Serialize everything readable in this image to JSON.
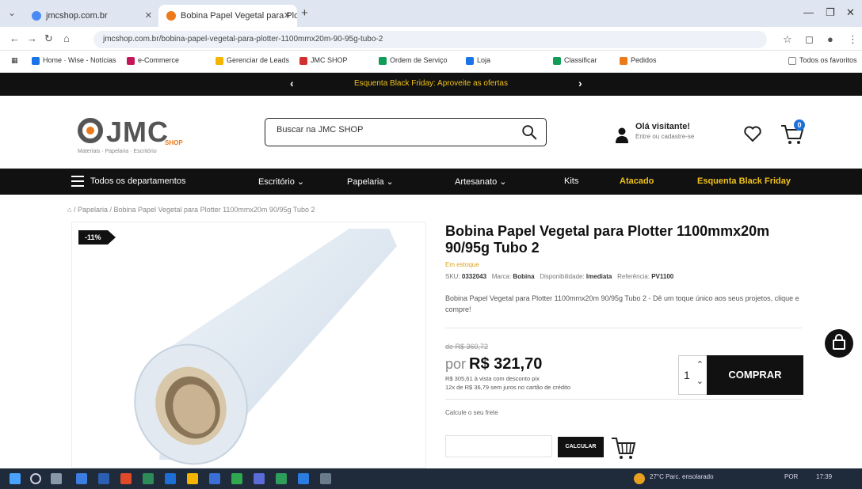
{
  "browser": {
    "tab1": {
      "title": "jmcshop.com.br"
    },
    "tab2": {
      "title": "Bobina Papel Vegetal para Plo"
    },
    "url": "jmcshop.com.br/bobina-papel-vegetal-para-plotter-1100mmx20m-90-95g-tubo-2",
    "bookmarks": [
      "Home",
      "Wise - Notícias",
      "e-Commerce",
      "Gerenciar de Leads",
      "JMC SHOP",
      "Ordem de Serviço",
      "Loja",
      "Classificar",
      "Pedidos"
    ],
    "all_bookmarks": "Todos os favoritos"
  },
  "promo": {
    "text": "Esquenta Black Friday: Aproveite as ofertas"
  },
  "header": {
    "logo_text": "JMC",
    "logo_shop": "SHOP",
    "logo_tagline": "Materiais · Papelaria · Escritório",
    "search_placeholder": "Buscar na JMC SHOP",
    "greeting": "Olá visitante!",
    "account_sub": "Entre ou cadastre-se",
    "cart_count": "0"
  },
  "nav": {
    "all_departments": "Todos os departamentos",
    "items": [
      "Escritório",
      "Papelaria",
      "Artesanato",
      "Kits",
      "Atacado",
      "Esquenta Black Friday"
    ]
  },
  "breadcrumb": "Papelaria / Bobina Papel Vegetal para Plotter 1100mmx20m 90/95g Tubo 2",
  "product": {
    "discount": "-11%",
    "title": "Bobina Papel Vegetal para Plotter 1100mmx20m 90/95g Tubo 2",
    "stock": "Em estoque",
    "meta_sku_label": "SKU:",
    "meta_sku": "0332043",
    "meta_brand_label": "Marca:",
    "meta_brand": "Bobina",
    "meta_avail_label": "Disponibilidade:",
    "meta_avail": "Imediata",
    "meta_ref_label": "Referência:",
    "meta_ref": "PV1100",
    "description": "Bobina Papel Vegetal para Plotter 1100mmx20m 90/95g Tubo 2 - Dê um toque único aos seus projetos, clique e compre!",
    "old_price": "de R$ 360,72",
    "price_prefix": "por",
    "price": "R$ 321,70",
    "pix_line": "R$ 305,61 à vista com desconto pix",
    "installments": "12x de R$ 36,79 sem juros no cartão de crédito",
    "qty": "1",
    "buy_label": "COMPRAR",
    "calc_label": "Calcule o seu frete",
    "calc_button": "CALCULAR"
  },
  "taskbar": {
    "weather": "27°C Parc. ensolarado",
    "lang": "POR",
    "time": "17:39"
  }
}
